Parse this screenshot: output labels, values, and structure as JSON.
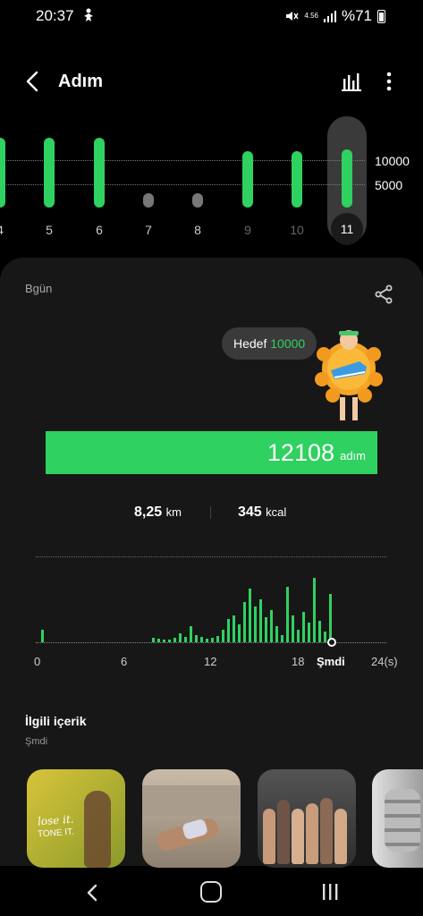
{
  "status_bar": {
    "time": "20:37",
    "network": "4.56",
    "battery": "%71",
    "icons": [
      "mute-icon",
      "signal-icon",
      "battery-icon",
      "fitness-icon"
    ]
  },
  "header": {
    "title": "Adım",
    "icons": [
      "back-arrow-icon",
      "bar-chart-icon",
      "more-vert-icon"
    ]
  },
  "week_chart": {
    "days": [
      "4",
      "5",
      "6",
      "7",
      "8",
      "9",
      "10",
      "11"
    ],
    "selected_day": "11",
    "goal_line": "10000",
    "mid_line": "5000",
    "accent": "#2fd160"
  },
  "today_card": {
    "label": "Bgün",
    "goal_prefix": "Hedef",
    "goal_value": "10000",
    "step_count": "12108",
    "step_unit": "adım",
    "distance_value": "8,25",
    "distance_unit": "km",
    "calories_value": "345",
    "calories_unit": "kcal"
  },
  "day_chart": {
    "x_labels": [
      "0",
      "6",
      "12",
      "18",
      "Şmdi",
      "24(s)"
    ],
    "current_marker": "Şmdi"
  },
  "related": {
    "title": "İlgili içerik",
    "subtitle": "Şmdi",
    "thumbnails": [
      {
        "line1": "lose it.",
        "line2": "TONE IT."
      },
      {
        "line1": "",
        "line2": ""
      },
      {
        "line1": "",
        "line2": ""
      },
      {
        "line1": "",
        "line2": ""
      }
    ]
  },
  "nav": {
    "icons": [
      "nav-back-icon",
      "nav-home-icon",
      "nav-recents-icon"
    ]
  }
}
